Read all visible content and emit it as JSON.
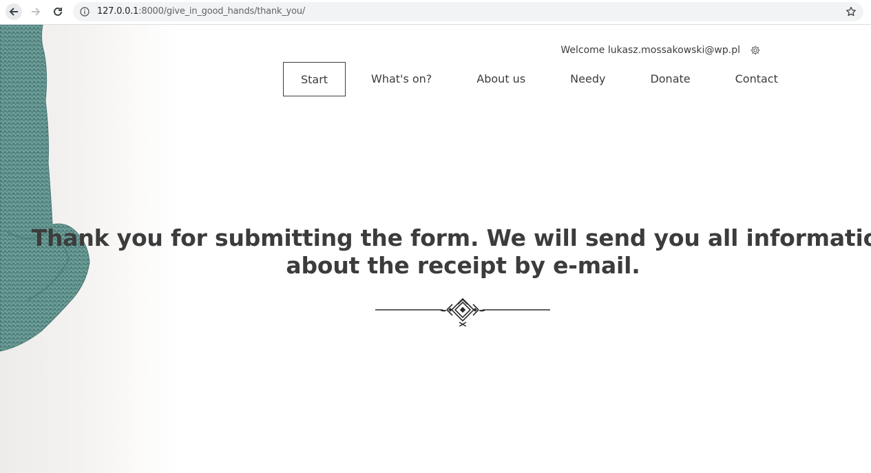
{
  "browser": {
    "url_host": "127.0.0.1",
    "url_rest": ":8000/give_in_good_hands/thank_you/"
  },
  "header": {
    "welcome_text": "Welcome lukasz.mossakowski@wp.pl"
  },
  "menu": {
    "items": [
      {
        "label": "Start",
        "active": true
      },
      {
        "label": "What's on?",
        "active": false
      },
      {
        "label": "About us",
        "active": false
      },
      {
        "label": "Needy",
        "active": false
      },
      {
        "label": "Donate",
        "active": false
      },
      {
        "label": "Contact",
        "active": false
      }
    ]
  },
  "main": {
    "heading_line1": "Thank you for submitting the form. We will send you all information",
    "heading_line2": "about the receipt by e-mail."
  },
  "icons": {
    "back": "arrow-left-icon",
    "forward": "arrow-right-icon",
    "reload": "reload-icon",
    "info": "info-icon",
    "star": "star-icon",
    "settings": "gear-icon",
    "ornament": "decoration-icon"
  },
  "colors": {
    "text": "#3c3c3c",
    "knit": "#5e8f8a"
  }
}
